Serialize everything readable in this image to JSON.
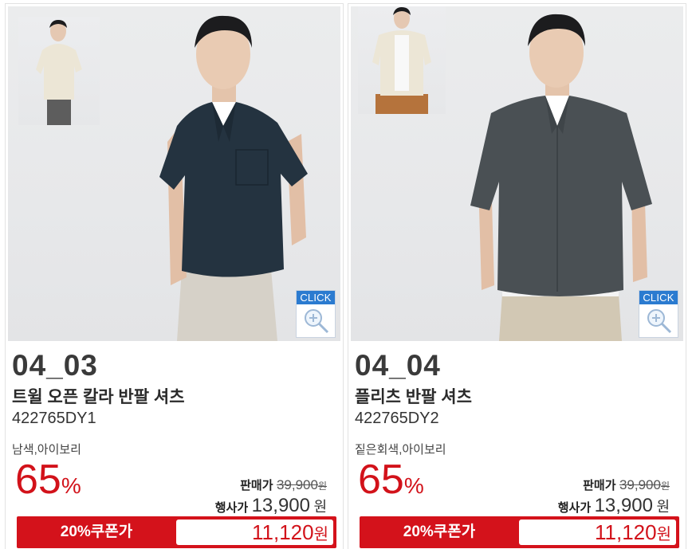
{
  "products": [
    {
      "code": "04_03",
      "name": "트윌 오픈 칼라 반팔 셔츠",
      "sku": "422765DY1",
      "colors": "남색,아이보리",
      "discount_value": "65",
      "discount_unit": "%",
      "list_price_label": "판매가",
      "list_price": "39,900",
      "list_price_unit": "원",
      "event_price_label": "행사가",
      "event_price": "13,900",
      "event_price_unit": "원",
      "coupon_label": "20%쿠폰가",
      "coupon_price": "11,120",
      "coupon_unit": "원",
      "click_label": "CLICK",
      "shirt_color": "#243340",
      "thumb_shirt_color": "#ece6d6"
    },
    {
      "code": "04_04",
      "name": "플리츠 반팔 셔츠",
      "sku": "422765DY2",
      "colors": "짙은회색,아이보리",
      "discount_value": "65",
      "discount_unit": "%",
      "list_price_label": "판매가",
      "list_price": "39,900",
      "list_price_unit": "원",
      "event_price_label": "행사가",
      "event_price": "13,900",
      "event_price_unit": "원",
      "coupon_label": "20%쿠폰가",
      "coupon_price": "11,120",
      "coupon_unit": "원",
      "click_label": "CLICK",
      "shirt_color": "#4a5054",
      "thumb_shirt_color": "#ece6d6"
    }
  ],
  "colors": {
    "accent_red": "#d2121a",
    "click_blue": "#2b7bd0"
  },
  "icons": {
    "zoom": "magnifier-plus-icon"
  }
}
